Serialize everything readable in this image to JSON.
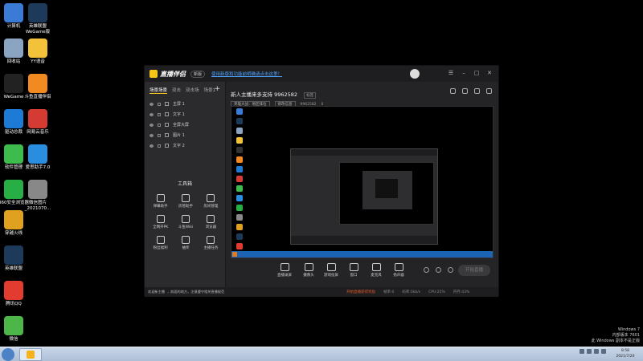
{
  "desktop": {
    "icons": [
      {
        "label": "计算机",
        "icon": "computer-icon",
        "color": "#3b7bd6"
      },
      {
        "label": "英雄联盟WeGame版",
        "icon": "lol-icon",
        "color": "#1d3a5a"
      },
      {
        "label": "回收站",
        "icon": "recycle-bin-icon",
        "color": "#8aa4c2"
      },
      {
        "label": "YY语音",
        "icon": "yy-icon",
        "color": "#f4c23a"
      },
      {
        "label": "WeGame",
        "icon": "wegame-icon",
        "color": "#222222"
      },
      {
        "label": "斗鱼直播伴侣",
        "icon": "douyu-icon",
        "color": "#f18a21"
      },
      {
        "label": "驱动总裁",
        "icon": "driver-icon",
        "color": "#1d7bd6"
      },
      {
        "label": "网易云音乐",
        "icon": "netease-music-icon",
        "color": "#d43c33"
      },
      {
        "label": "软件管理",
        "icon": "software-manager-icon",
        "color": "#3dbb4d"
      },
      {
        "label": "爱思助手7.0",
        "icon": "i4-icon",
        "color": "#2a8ee0"
      },
      {
        "label": "360安全浏览器",
        "icon": "360-browser-icon",
        "color": "#27ae45"
      },
      {
        "label": "微信图片_2021070...",
        "icon": "image-file-icon",
        "color": "#888888"
      },
      {
        "label": "穿越火线",
        "icon": "cf-icon",
        "color": "#e0a020"
      },
      {
        "label": "英雄联盟",
        "icon": "lol-client-icon",
        "color": "#1d3a5a"
      },
      {
        "label": "腾讯QQ",
        "icon": "qq-icon",
        "color": "#e23b2f"
      },
      {
        "label": "微信",
        "icon": "wechat-icon",
        "color": "#4cb649"
      }
    ],
    "watermark": {
      "line1": "Windows 7",
      "line2": "内部版本 7601",
      "line3": "此 Windows 副本不是正版"
    }
  },
  "app": {
    "name": "直播伴侣",
    "version_badge": "新版",
    "notice": "使用新版和功能前明确请点击这里！",
    "window_controls": [
      "min",
      "restore",
      "close"
    ],
    "sidebar": {
      "tabs": [
        "场景场景",
        "双击",
        "双击场",
        "场景1"
      ],
      "sources": [
        "主屏 1",
        "文字 1",
        "全屏大屏",
        "图片 1",
        "文字 2"
      ],
      "toolbox_title": "工具箱",
      "tools": [
        "弹幕助手",
        "房管助手",
        "房间管理",
        "全网开PK",
        "斗鱼Wiki",
        "浏览器",
        "粉丝福利",
        "抽奖",
        "主播任务"
      ]
    },
    "room": {
      "title": "新人主播来多支持 9962582",
      "tag": "标签",
      "category": "英雄大战：地区排位",
      "edit_label": "修改信息",
      "room_id": "9962582",
      "fans": "0"
    },
    "controls": [
      "直播录屏",
      "摄像头",
      "游戏投屏",
      "窗口",
      "麦克风",
      "扬声器"
    ],
    "start_live": "开始直播",
    "status": {
      "warning": "开始直播获得奖励",
      "fps": "帧率:0",
      "bitrate": "码率:0kb/s",
      "cpu": "CPU:25%",
      "mem": "内存:43%"
    },
    "notification": {
      "prefix": "欢迎新主播",
      "text": "，前面的地方，注意遵守相关直播规范",
      "link": "查看规则"
    }
  },
  "taskbar": {
    "clock_time": "8:58",
    "clock_date": "2021/7/20"
  }
}
